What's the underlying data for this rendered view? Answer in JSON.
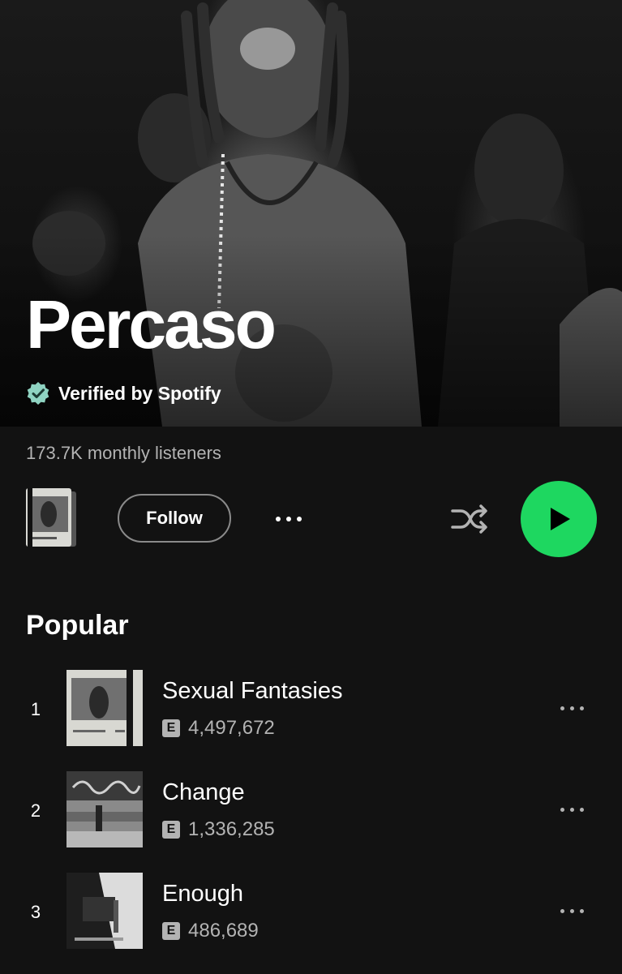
{
  "artist": {
    "name": "Percaso",
    "verified_label": "Verified by Spotify",
    "monthly_listeners": "173.7K monthly listeners"
  },
  "actions": {
    "follow_label": "Follow",
    "more_icon": "more-horizontal-icon",
    "shuffle_icon": "shuffle-icon",
    "play_icon": "play-icon"
  },
  "popular": {
    "title": "Popular",
    "tracks": [
      {
        "rank": "1",
        "title": "Sexual Fantasies",
        "explicit": "E",
        "plays": "4,497,672"
      },
      {
        "rank": "2",
        "title": "Change",
        "explicit": "E",
        "plays": "1,336,285"
      },
      {
        "rank": "3",
        "title": "Enough",
        "explicit": "E",
        "plays": "486,689"
      }
    ]
  },
  "colors": {
    "background": "#121212",
    "accent": "#1ed760",
    "secondary_text": "#b3b3b3",
    "verified_badge": "#4cb3a0"
  }
}
